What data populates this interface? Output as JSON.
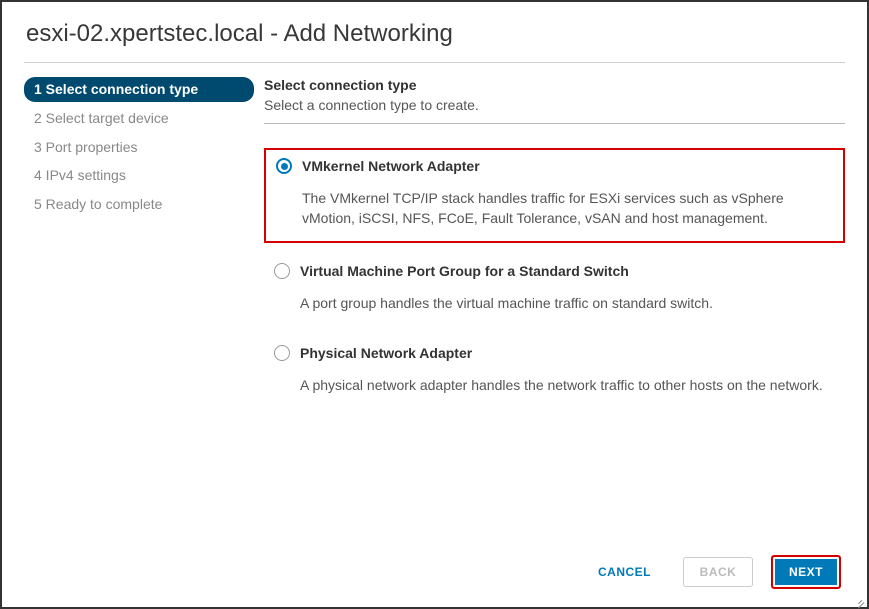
{
  "dialog": {
    "title": "esxi-02.xpertstec.local - Add Networking"
  },
  "sidebar": {
    "steps": [
      {
        "label": "1 Select connection type",
        "active": true
      },
      {
        "label": "2 Select target device",
        "active": false
      },
      {
        "label": "3 Port properties",
        "active": false
      },
      {
        "label": "4 IPv4 settings",
        "active": false
      },
      {
        "label": "5 Ready to complete",
        "active": false
      }
    ]
  },
  "main": {
    "heading": "Select connection type",
    "subheading": "Select a connection type to create.",
    "options": [
      {
        "label": "VMkernel Network Adapter",
        "desc": "The VMkernel TCP/IP stack handles traffic for ESXi services such as vSphere vMotion, iSCSI, NFS, FCoE, Fault Tolerance, vSAN and host management.",
        "checked": true,
        "highlighted": true
      },
      {
        "label": "Virtual Machine Port Group for a Standard Switch",
        "desc": "A port group handles the virtual machine traffic on standard switch.",
        "checked": false,
        "highlighted": false
      },
      {
        "label": "Physical Network Adapter",
        "desc": "A physical network adapter handles the network traffic to other hosts on the network.",
        "checked": false,
        "highlighted": false
      }
    ]
  },
  "footer": {
    "cancel": "CANCEL",
    "back": "BACK",
    "next": "NEXT"
  }
}
